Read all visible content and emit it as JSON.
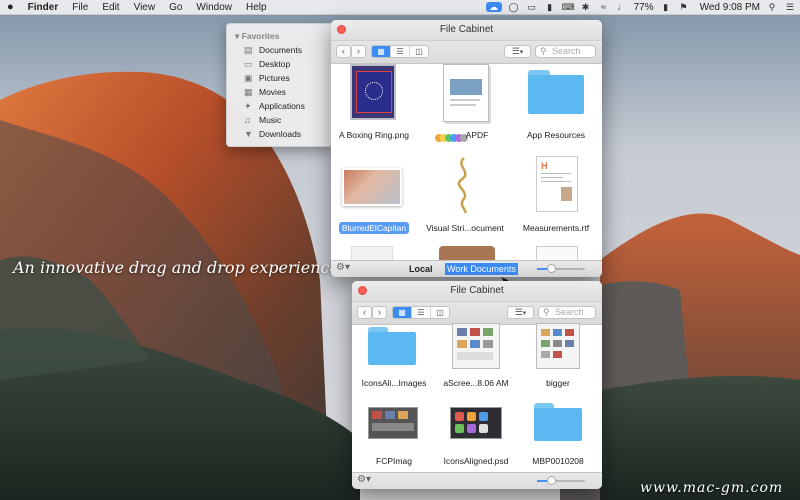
{
  "menubar": {
    "apple": "",
    "app": "Finder",
    "items": [
      "File",
      "Edit",
      "View",
      "Go",
      "Window",
      "Help"
    ],
    "battery": "77%",
    "clock": "Wed 9:08 PM"
  },
  "tagline": "An innovative drag and drop experience.",
  "sidebar": {
    "header": "Favorites",
    "items": [
      {
        "label": "Documents",
        "icon": "documents-icon"
      },
      {
        "label": "Desktop",
        "icon": "desktop-icon"
      },
      {
        "label": "Pictures",
        "icon": "pictures-icon"
      },
      {
        "label": "Movies",
        "icon": "movies-icon"
      },
      {
        "label": "Applications",
        "icon": "applications-icon"
      },
      {
        "label": "Music",
        "icon": "music-icon"
      },
      {
        "label": "Downloads",
        "icon": "downloads-icon"
      }
    ]
  },
  "window1": {
    "title": "File Cabinet",
    "search_placeholder": "Search",
    "files": [
      {
        "name": "A Boxing Ring.png",
        "icon": "image-file-icon"
      },
      {
        "name": "APDF",
        "icon": "pdf-file-icon"
      },
      {
        "name": "App Resources",
        "icon": "folder-icon"
      },
      {
        "name": "BlurredElCapitan",
        "icon": "image-file-icon",
        "selected": true
      },
      {
        "name": "Visual Stri...ocument",
        "icon": "document-file-icon"
      },
      {
        "name": "Measurements.rtf",
        "icon": "rtf-file-icon"
      }
    ],
    "tabs": {
      "local": "Local",
      "work": "Work Documents"
    }
  },
  "window2": {
    "title": "File Cabinet",
    "search_placeholder": "Search",
    "files": [
      {
        "name": "IconsAli...Images",
        "icon": "folder-icon"
      },
      {
        "name": "aScree...8.06 AM",
        "icon": "screenshot-file-icon"
      },
      {
        "name": "bigger",
        "icon": "image-file-icon"
      },
      {
        "name": "FCPImag",
        "icon": "image-file-icon"
      },
      {
        "name": "IconsAligned.psd",
        "icon": "psd-file-icon"
      },
      {
        "name": "MBP0010208",
        "icon": "folder-icon"
      }
    ]
  },
  "watermark": "www.mac-gm.com",
  "colors": {
    "accent": "#3b8cf5",
    "folder": "#5bb8f0",
    "close": "#fc5f57"
  }
}
